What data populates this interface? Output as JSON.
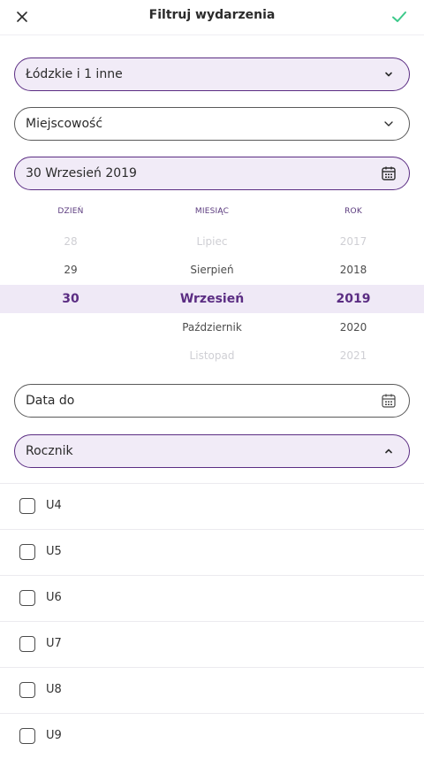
{
  "header": {
    "title": "Filtruj wydarzenia",
    "close_icon": "close-icon",
    "confirm_icon": "check-icon",
    "confirm_color": "#3cc98a"
  },
  "filters": {
    "region": {
      "label": "Łódzkie i 1 inne",
      "icon": "chevron-down-icon"
    },
    "city": {
      "label": "Miejscowość",
      "icon": "chevron-down-icon"
    },
    "date_from": {
      "label": "30 Wrzesień 2019",
      "icon": "calendar-icon"
    },
    "date_to": {
      "label": "Data do",
      "icon": "calendar-icon"
    },
    "year_group": {
      "label": "Rocznik",
      "icon": "chevron-up-icon"
    }
  },
  "date_picker": {
    "headers": {
      "day": "DZIEŃ",
      "month": "MIESIĄC",
      "year": "ROK"
    },
    "rows": [
      {
        "day": "28",
        "month": "Lipiec",
        "year": "2017",
        "state": "faint"
      },
      {
        "day": "29",
        "month": "Sierpień",
        "year": "2018",
        "state": "near"
      },
      {
        "day": "30",
        "month": "Wrzesień",
        "year": "2019",
        "state": "selected"
      },
      {
        "day": "",
        "month": "Październik",
        "year": "2020",
        "state": "near"
      },
      {
        "day": "",
        "month": "Listopad",
        "year": "2021",
        "state": "faint"
      }
    ]
  },
  "year_options": [
    {
      "label": "U4",
      "checked": false
    },
    {
      "label": "U5",
      "checked": false
    },
    {
      "label": "U6",
      "checked": false
    },
    {
      "label": "U7",
      "checked": false
    },
    {
      "label": "U8",
      "checked": false
    },
    {
      "label": "U9",
      "checked": false
    }
  ],
  "colors": {
    "accent": "#5b2d83",
    "accent_bg": "#f1ebf7",
    "selected_row_bg": "#efe9f6"
  }
}
